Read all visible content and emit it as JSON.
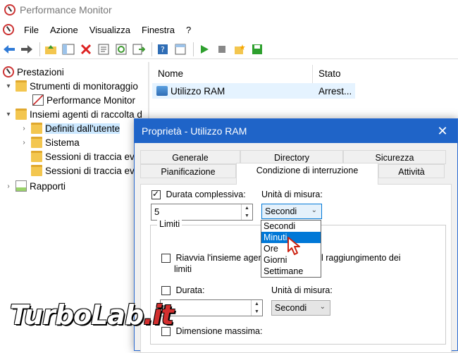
{
  "window": {
    "title": "Performance Monitor"
  },
  "menu": [
    "File",
    "Azione",
    "Visualizza",
    "Finestra",
    "?"
  ],
  "toolbar": {
    "icons": [
      "back-arrow-icon",
      "forward-arrow-icon",
      "folder-up-icon",
      "show-hide-tree-icon",
      "delete-icon",
      "properties-icon",
      "refresh-icon",
      "export-icon",
      "help-icon",
      "view-icon",
      "start-icon",
      "stop-icon",
      "new-icon",
      "save-icon"
    ]
  },
  "tree": {
    "items": [
      {
        "label": "Prestazioni"
      },
      {
        "label": "Strumenti di monitoraggio"
      },
      {
        "label": "Performance Monitor"
      },
      {
        "label": "Insiemi agenti di raccolta d"
      },
      {
        "label": "Definiti dall'utente"
      },
      {
        "label": "Sistema"
      },
      {
        "label": "Sessioni di traccia ev"
      },
      {
        "label": "Sessioni di traccia ev"
      },
      {
        "label": "Rapporti"
      }
    ]
  },
  "list": {
    "columns": [
      "Nome",
      "Stato"
    ],
    "rows": [
      {
        "name": "Utilizzo RAM",
        "state": "Arrest..."
      }
    ]
  },
  "dialog": {
    "title": "Proprietà - Utilizzo RAM",
    "tabs_row1": [
      "Generale",
      "Directory",
      "Sicurezza"
    ],
    "tabs_row2": [
      "Pianificazione",
      "Condizione di interruzione",
      "Attività"
    ],
    "active_tab": "Condizione di interruzione",
    "overall_duration": {
      "label": "Durata complessiva:",
      "checked": true,
      "value": "5"
    },
    "units_label": "Unità di misura:",
    "units_selected": "Secondi",
    "units_options": [
      "Secondi",
      "Minuti",
      "Ore",
      "Giorni",
      "Settimane"
    ],
    "units_highlighted": "Minuti",
    "limits": {
      "title": "Limiti",
      "restart_label_a": "Riavvia l'insieme agenti",
      "restart_label_b": "l raggiungimento dei",
      "restart_label_c": "limiti",
      "duration_label": "Durata:",
      "duration_value": "0",
      "duration_units_label": "Unità di misura:",
      "duration_units_value": "Secondi",
      "max_size_label": "Dimensione massima:"
    }
  },
  "watermark": {
    "part1": "TurboLab",
    "part2": ".it"
  }
}
